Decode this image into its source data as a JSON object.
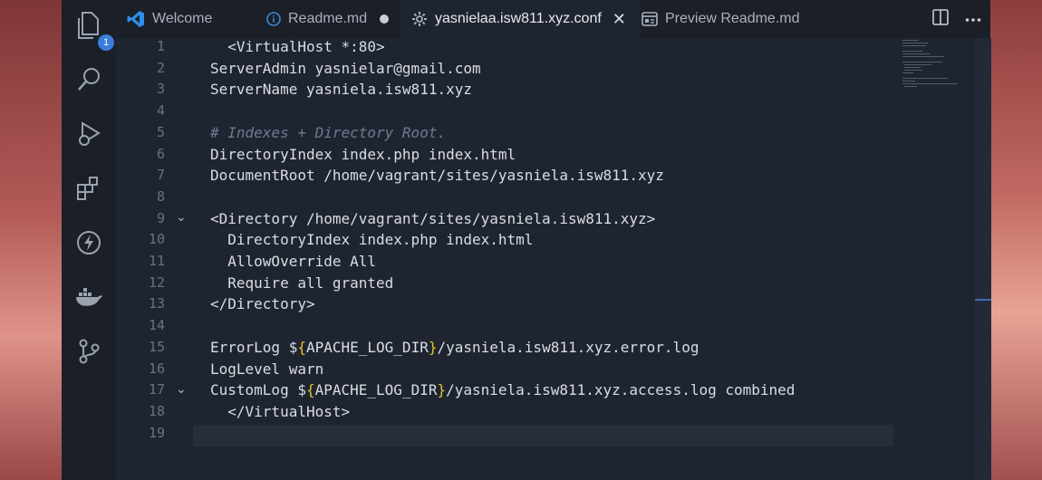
{
  "tabs": [
    {
      "label": "Welcome",
      "icon": "vscode-logo-icon"
    },
    {
      "label": "Readme.md",
      "icon": "info-icon",
      "modified": true
    },
    {
      "label": "yasnielaa.isw811.xyz.conf",
      "icon": "gear-icon",
      "active": true
    },
    {
      "label": "Preview Readme.md",
      "icon": "preview-icon"
    }
  ],
  "activity_bar": {
    "explorer_badge": "1",
    "items": [
      "files-icon",
      "search-icon",
      "run-debug-icon",
      "extensions-icon",
      "lightning-icon",
      "docker-icon",
      "source-control-icon"
    ]
  },
  "line_numbers": [
    "1",
    "2",
    "3",
    "4",
    "5",
    "6",
    "7",
    "8",
    "9",
    "10",
    "11",
    "12",
    "13",
    "14",
    "15",
    "16",
    "17",
    "18",
    "19"
  ],
  "code_lines": [
    "  <VirtualHost *:80>",
    "ServerAdmin yasnielar@gmail.com",
    "ServerName yasniela.isw811.xyz",
    "",
    "# Indexes + Directory Root.",
    "DirectoryIndex index.php index.html",
    "DocumentRoot /home/vagrant/sites/yasniela.isw811.xyz",
    "",
    "<Directory /home/vagrant/sites/yasniela.isw811.xyz>",
    "  DirectoryIndex index.php index.html",
    "  AllowOverride All",
    "  Require all granted",
    "</Directory>",
    "",
    "ErrorLog ${APACHE_LOG_DIR}/yasniela.isw811.xyz.error.log",
    "LogLevel warn",
    "CustomLog ${APACHE_LOG_DIR}/yasniela.isw811.xyz.access.log combined",
    "  </VirtualHost>",
    ""
  ],
  "fold_markers": [
    "9",
    "17"
  ],
  "colors": {
    "accent": "#3b7ddb",
    "brace": "#e6c229",
    "comment": "#6d7b92"
  }
}
